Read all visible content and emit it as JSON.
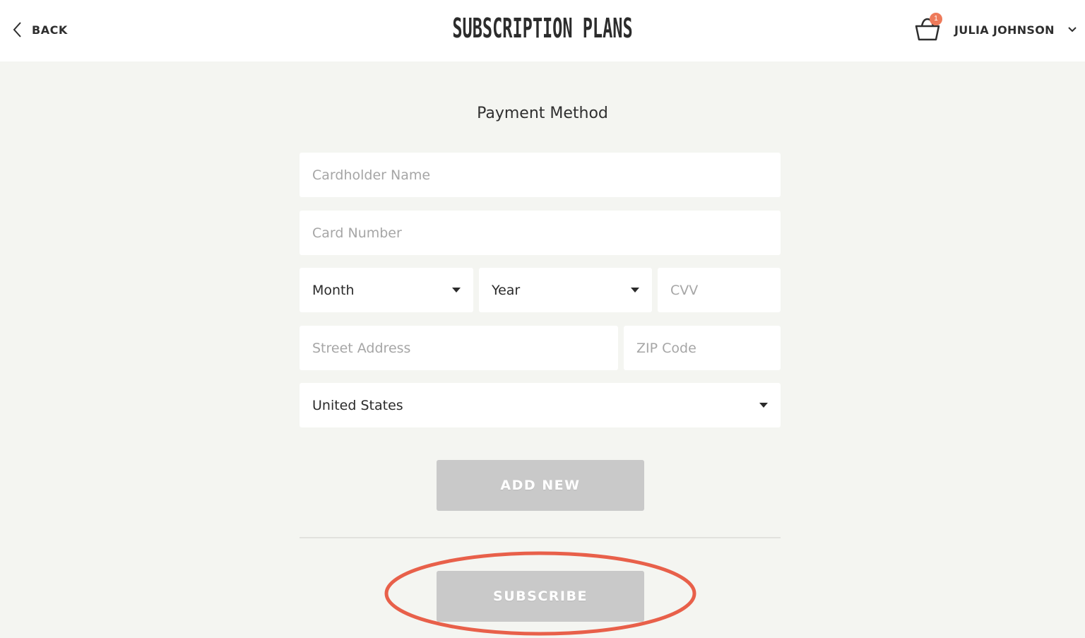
{
  "header": {
    "back_label": "BACK",
    "title": "SUBSCRIPTION PLANS",
    "cart_count": "1",
    "user_name": "JULIA JOHNSON"
  },
  "form": {
    "section_title": "Payment Method",
    "cardholder_placeholder": "Cardholder Name",
    "card_number_placeholder": "Card Number",
    "month_value": "Month",
    "year_value": "Year",
    "cvv_placeholder": "CVV",
    "street_placeholder": "Street Address",
    "zip_placeholder": "ZIP Code",
    "country_value": "United States"
  },
  "buttons": {
    "add_new_label": "ADD NEW",
    "subscribe_label": "SUBSCRIBE"
  },
  "colors": {
    "accent": "#ee7a5a",
    "annotation": "#e8604a",
    "button_disabled": "#c9c9c9",
    "background": "#f4f5f1"
  },
  "icons": [
    "chevron-left-icon",
    "shopping-basket-icon",
    "chevron-down-icon",
    "caret-down-icon"
  ]
}
